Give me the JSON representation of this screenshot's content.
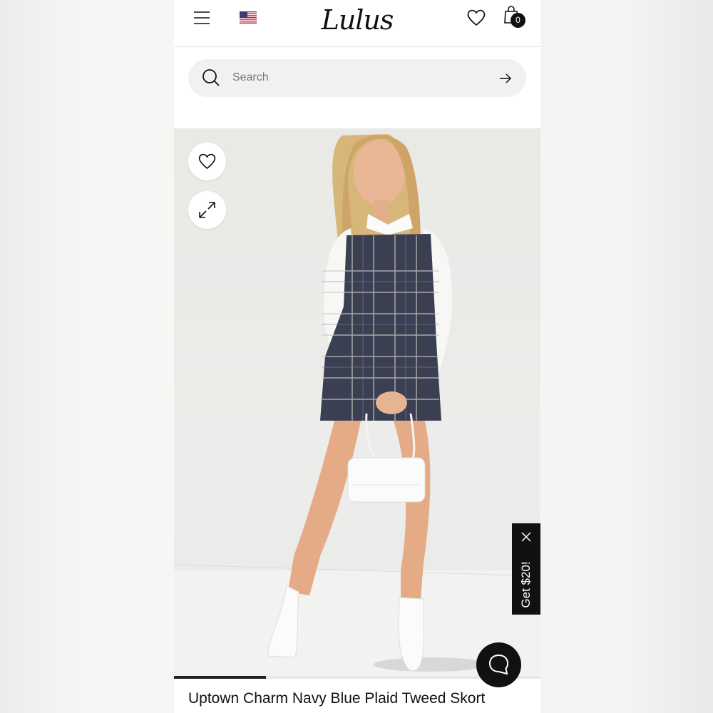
{
  "header": {
    "logo_text": "Lulus",
    "menu_icon": "hamburger-menu-icon",
    "flag_icon": "us-flag-icon",
    "wishlist_icon": "heart-icon",
    "bag_icon": "shopping-bag-icon",
    "bag_count": "0"
  },
  "search": {
    "placeholder": "Search",
    "value": "",
    "icon": "search-icon",
    "submit_icon": "arrow-right-icon"
  },
  "gallery": {
    "favorite_icon": "heart-icon",
    "expand_icon": "expand-arrows-icon",
    "image_progress": 0.25
  },
  "promo": {
    "label": "Get $20!",
    "close_icon": "close-icon"
  },
  "chat": {
    "icon": "chat-bubble-icon"
  },
  "product": {
    "title": "Uptown Charm Navy Blue Plaid Tweed Skort"
  },
  "colors": {
    "text": "#111111",
    "search_bg": "#f1f1f1",
    "accent_dark": "#111111"
  }
}
